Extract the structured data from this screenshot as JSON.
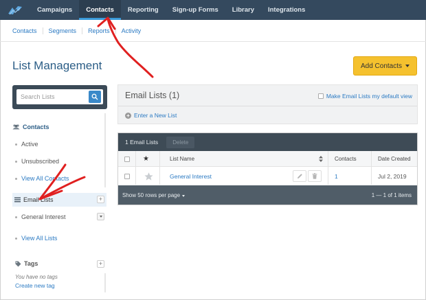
{
  "topnav": {
    "items": [
      {
        "label": "Campaigns"
      },
      {
        "label": "Contacts"
      },
      {
        "label": "Reporting"
      },
      {
        "label": "Sign-up Forms"
      },
      {
        "label": "Library"
      },
      {
        "label": "Integrations"
      }
    ],
    "active": "Contacts"
  },
  "subnav": {
    "items": [
      {
        "label": "Contacts"
      },
      {
        "label": "Segments"
      },
      {
        "label": "Reports"
      },
      {
        "label": "Activity"
      }
    ]
  },
  "page": {
    "title": "List Management",
    "add_contacts_label": "Add Contacts"
  },
  "sidebar": {
    "search_placeholder": "Search Lists",
    "contacts_header": "Contacts",
    "contact_links": [
      "Active",
      "Unsubscribed",
      "View All Contacts"
    ],
    "email_lists_label": "Email Lists",
    "list_items": [
      "General Interest"
    ],
    "view_all_lists": "View All Lists",
    "tags_header": "Tags",
    "tags_empty": "You have no tags",
    "create_tag": "Create new tag"
  },
  "lists_panel": {
    "title": "Email Lists (1)",
    "default_link": "Make Email Lists my default view",
    "enter_new": "Enter a New List"
  },
  "table": {
    "selected_count": "1 Email Lists",
    "delete_label": "Delete",
    "columns": {
      "star": "★",
      "list_name": "List Name",
      "contacts": "Contacts",
      "date_created": "Date Created"
    },
    "rows": [
      {
        "name": "General Interest",
        "contacts": "1",
        "date_created": "Jul 2, 2019"
      }
    ],
    "rows_per_page": "Show 50 rows per page",
    "pagination": "1 — 1 of 1 items"
  },
  "colors": {
    "nav_bg": "#34495e",
    "accent_blue": "#2b7ac3",
    "add_button": "#f5c12e",
    "annotation_red": "#e02020"
  }
}
